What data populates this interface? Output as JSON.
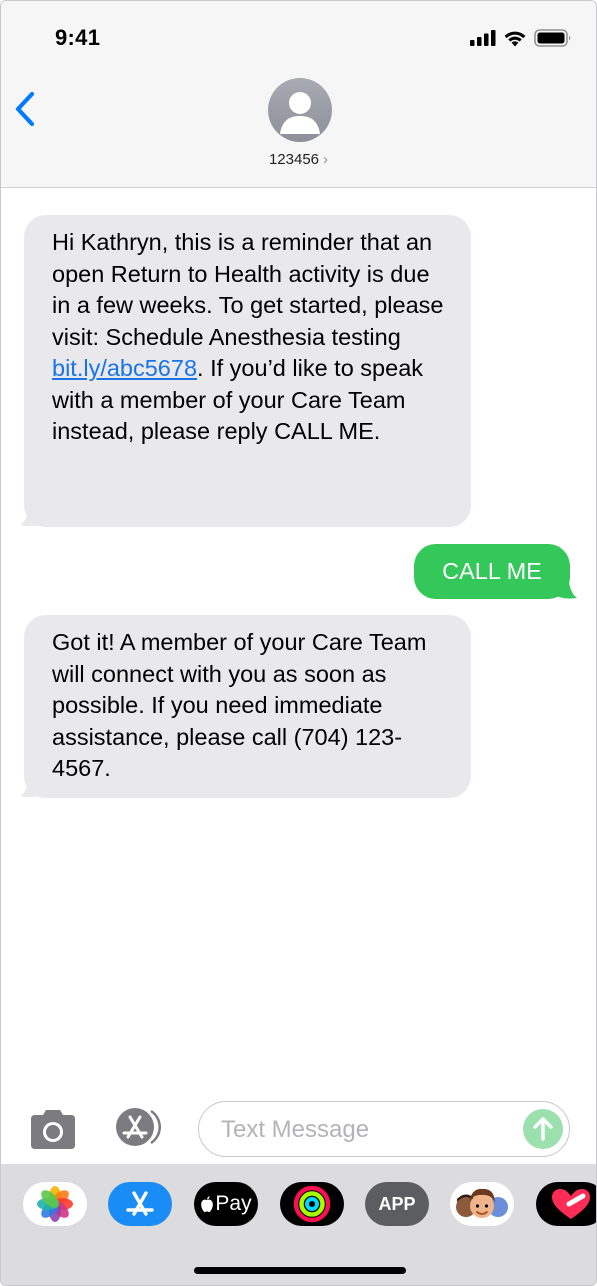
{
  "status_bar": {
    "time": "9:41",
    "icons": [
      "signal-icon",
      "wifi-icon",
      "battery-icon"
    ]
  },
  "header": {
    "contact": "123456",
    "chevron": "›",
    "icons": [
      "back-chevron-icon",
      "person-avatar-icon"
    ]
  },
  "messages": [
    {
      "direction": "incoming",
      "text_before": "Hi Kathryn, this is a reminder that an open Return to Health activity is due in a few weeks. To get started, please visit: Schedule Anesthesia testing ",
      "link": "bit.ly/abc5678",
      "text_after": ". If you’d like to speak with a member of your Care Team instead, please reply CALL ME."
    },
    {
      "direction": "outgoing",
      "text": "CALL ME"
    },
    {
      "direction": "incoming",
      "text": "Got it! A member of your Care Team will connect with you as soon as possible. If you need immediate assistance, please call (704) 123-4567."
    }
  ],
  "composer": {
    "placeholder": "Text Message",
    "icons": [
      "camera-icon",
      "app-store-icon",
      "send-arrow-icon"
    ]
  },
  "app_drawer": {
    "apps": [
      {
        "name": "photos-app-icon"
      },
      {
        "name": "app-store-app-icon"
      },
      {
        "name": "apple-pay-app-icon",
        "label": "Pay"
      },
      {
        "name": "fitness-app-icon"
      },
      {
        "name": "generic-app-icon",
        "label": "APP"
      },
      {
        "name": "memoji-app-icon"
      },
      {
        "name": "heart-sticker-app-icon"
      }
    ]
  },
  "colors": {
    "incoming_bubble": "#e9e9eb",
    "outgoing_bubble": "#34c759",
    "link": "#1a73e8",
    "ios_blue": "#007aff"
  }
}
